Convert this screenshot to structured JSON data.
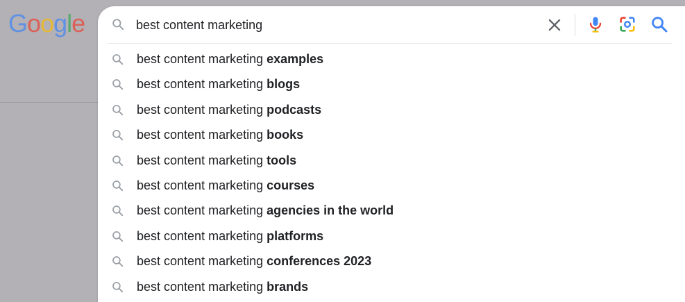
{
  "logo": {
    "letters": [
      "G",
      "o",
      "o",
      "g",
      "l",
      "e"
    ],
    "colors": [
      "#4285F4",
      "#EA4335",
      "#FBBC05",
      "#4285F4",
      "#34A853",
      "#EA4335"
    ]
  },
  "search": {
    "value": "best content marketing"
  },
  "icons": {
    "search": "search-icon",
    "clear": "close-icon",
    "mic": "microphone-icon",
    "lens": "camera-lens-icon",
    "submit": "search-icon"
  },
  "colors": {
    "icon_gray": "#5f6368",
    "blue": "#4285F4",
    "red": "#EA4335",
    "yellow": "#FBBC05",
    "green": "#34A853"
  },
  "suggestions": [
    {
      "prefix": "best content marketing ",
      "completion": "examples"
    },
    {
      "prefix": "best content marketing ",
      "completion": "blogs"
    },
    {
      "prefix": "best content marketing ",
      "completion": "podcasts"
    },
    {
      "prefix": "best content marketing ",
      "completion": "books"
    },
    {
      "prefix": "best content marketing ",
      "completion": "tools"
    },
    {
      "prefix": "best content marketing ",
      "completion": "courses"
    },
    {
      "prefix": "best content marketing ",
      "completion": "agencies in the world"
    },
    {
      "prefix": "best content marketing ",
      "completion": "platforms"
    },
    {
      "prefix": "best content marketing ",
      "completion": "conferences 2023"
    },
    {
      "prefix": "best content marketing ",
      "completion": "brands"
    }
  ]
}
